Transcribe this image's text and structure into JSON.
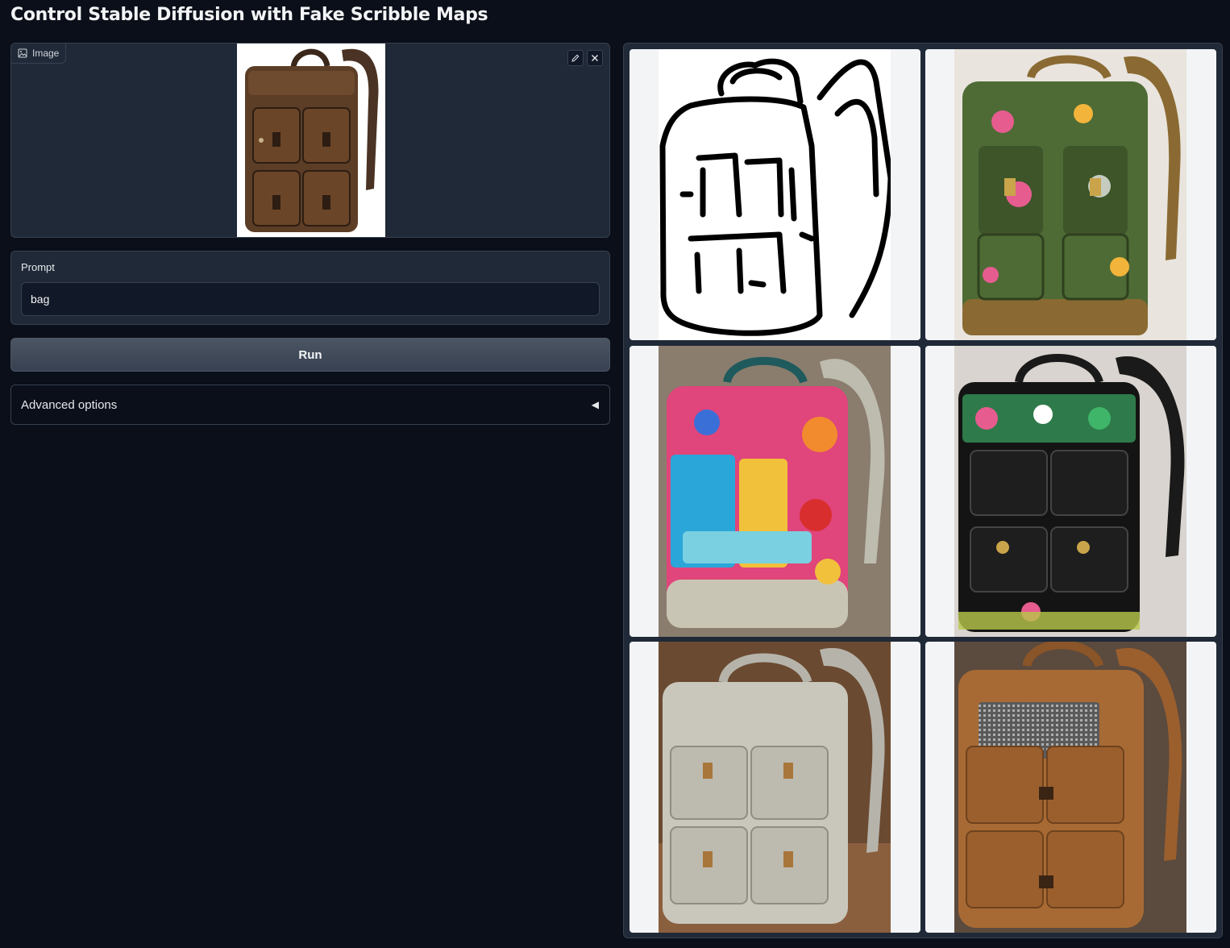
{
  "page": {
    "title": "Control Stable Diffusion with Fake Scribble Maps"
  },
  "image_input": {
    "label": "Image",
    "icon": "image-icon",
    "tools": [
      "edit-icon",
      "close-icon"
    ]
  },
  "prompt": {
    "label": "Prompt",
    "value": "bag"
  },
  "run": {
    "label": "Run"
  },
  "advanced": {
    "label": "Advanced options",
    "caret": "◀"
  },
  "gallery": {
    "items": [
      {
        "kind": "scribble",
        "colors": {
          "main": "#ffffff",
          "accent": "#000000"
        }
      },
      {
        "kind": "backpack",
        "colors": {
          "main": "#4e6b35",
          "accent": "#e65c8f",
          "strap": "#8a6a32",
          "bg": "#e9e4de"
        }
      },
      {
        "kind": "backpack",
        "colors": {
          "main": "#e0457b",
          "accent": "#2aa6d9",
          "strap": "#bdbcaf",
          "bg": "#8a7d6e"
        }
      },
      {
        "kind": "backpack",
        "colors": {
          "main": "#141414",
          "accent": "#3fb56a",
          "strap": "#1a1a1a",
          "bg": "#d9d4cf"
        }
      },
      {
        "kind": "backpack",
        "colors": {
          "main": "#c9c7bb",
          "accent": "#a8763a",
          "strap": "#b6b4aa",
          "bg": "#6b4a32"
        }
      },
      {
        "kind": "backpack",
        "colors": {
          "main": "#a86a34",
          "accent": "#5a5a5a",
          "strap": "#9b5f2d",
          "bg": "#5b4a3e"
        }
      }
    ]
  }
}
